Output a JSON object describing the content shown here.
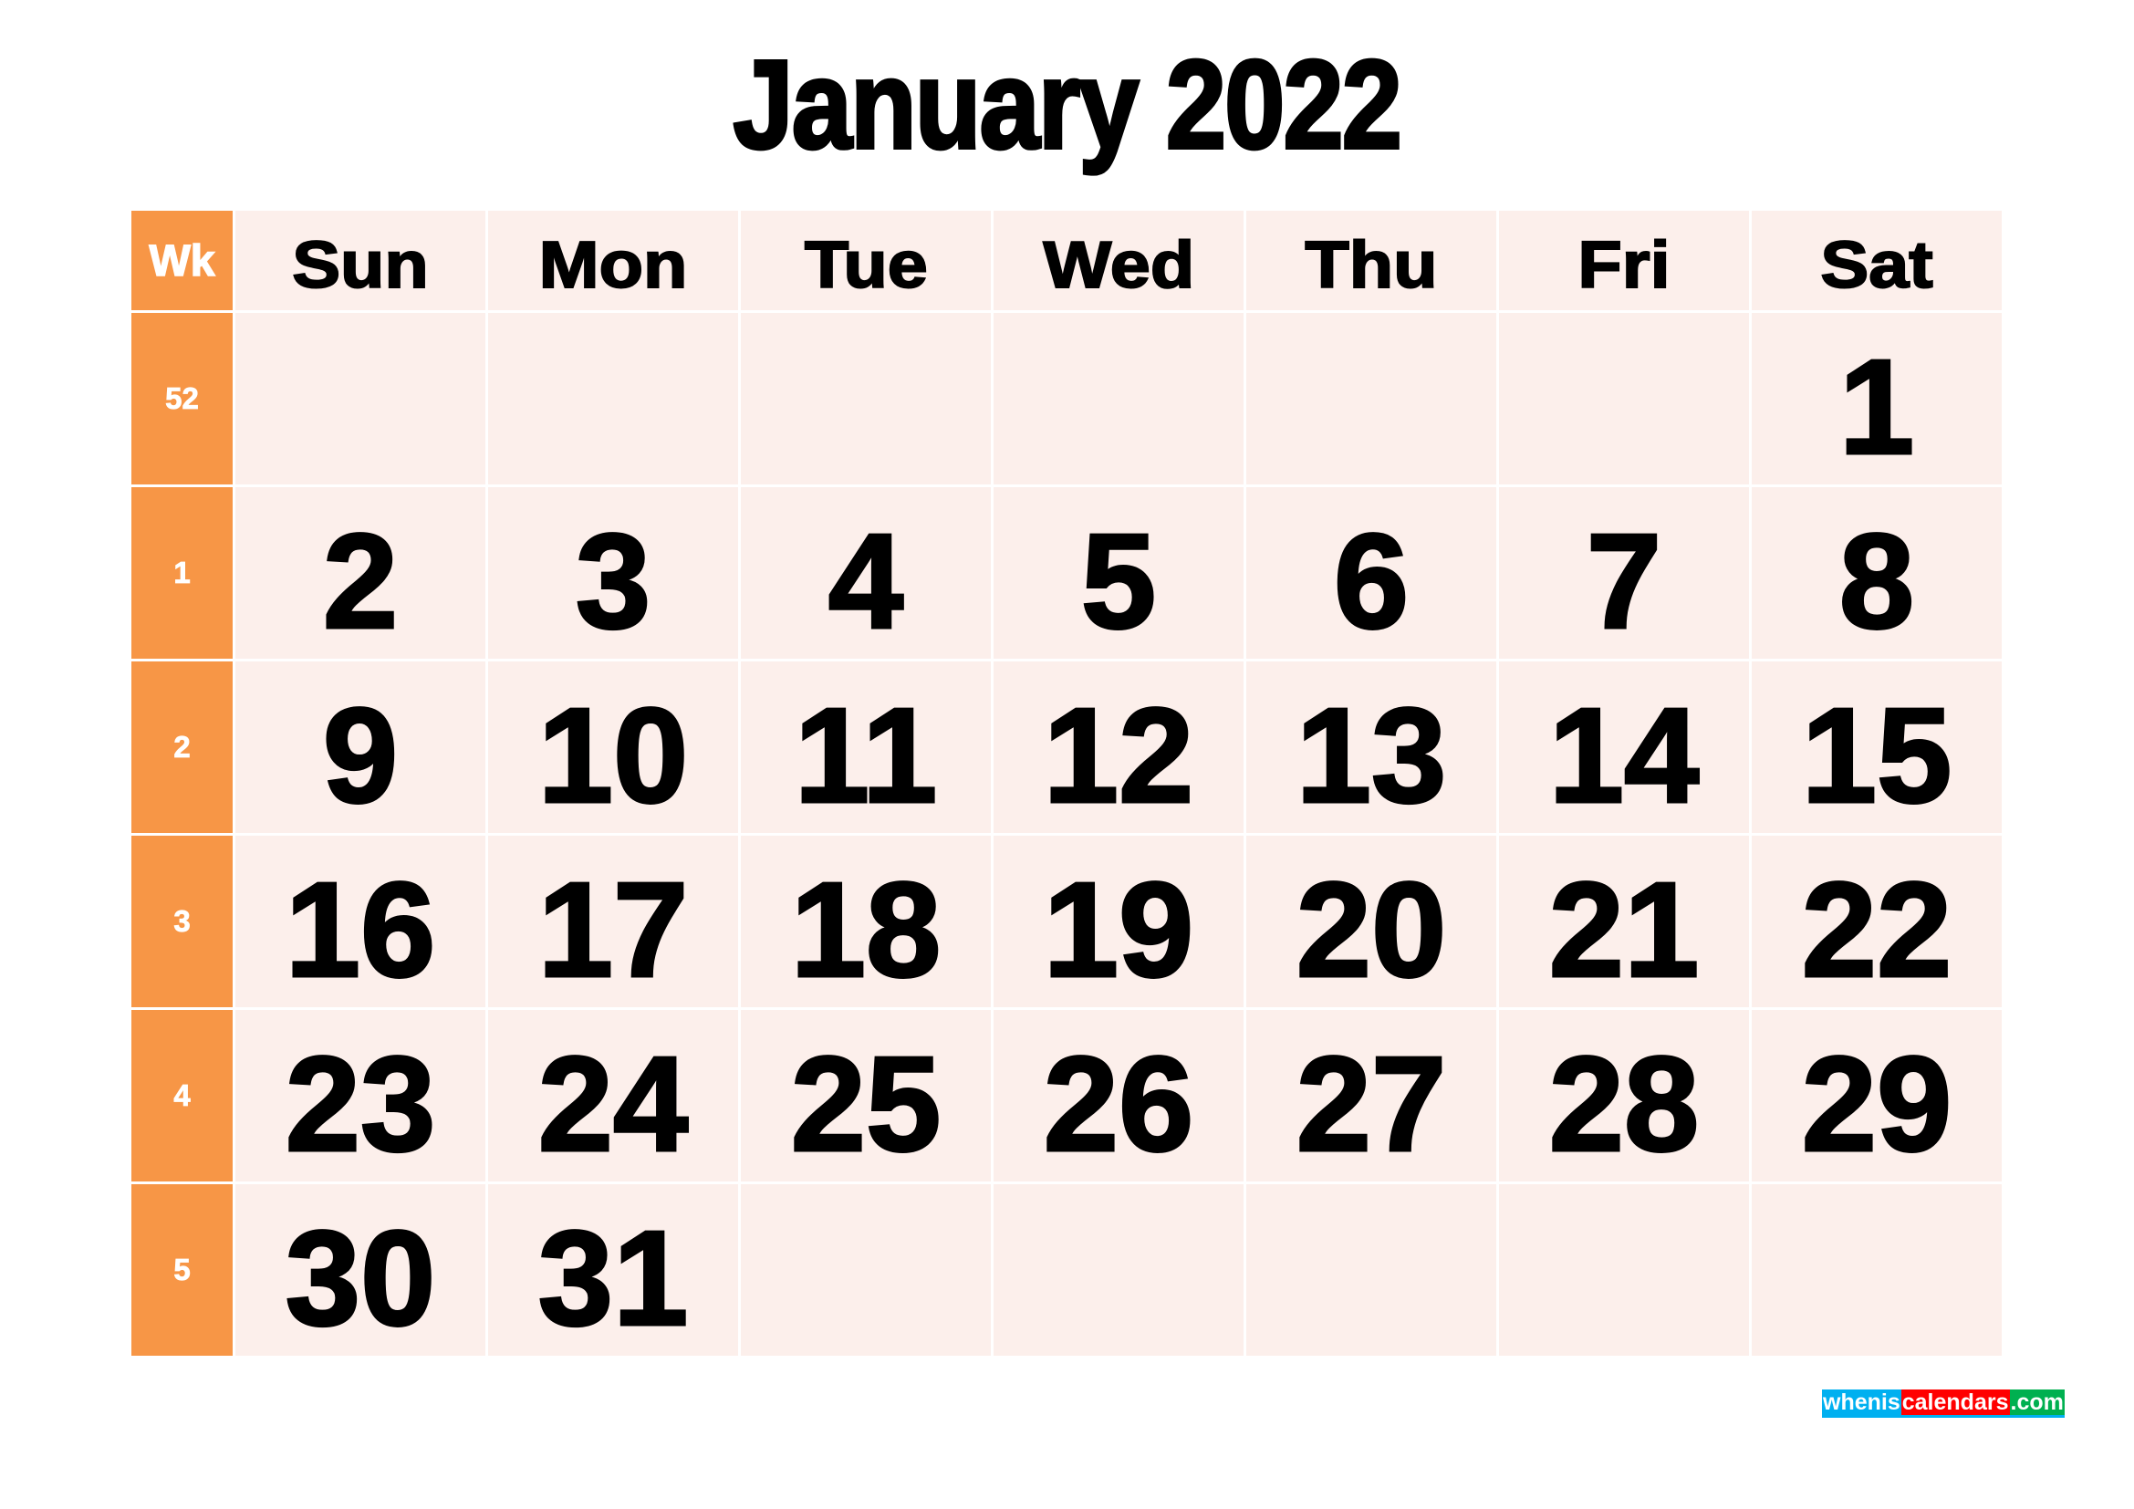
{
  "title": "January 2022",
  "month": "January",
  "year": "2022",
  "header": {
    "week_label": "Wk",
    "weekdays": [
      "Sun",
      "Mon",
      "Tue",
      "Wed",
      "Thu",
      "Fri",
      "Sat"
    ]
  },
  "weeks": [
    {
      "week": "52",
      "days": [
        "",
        "",
        "",
        "",
        "",
        "",
        "1"
      ]
    },
    {
      "week": "1",
      "days": [
        "2",
        "3",
        "4",
        "5",
        "6",
        "7",
        "8"
      ]
    },
    {
      "week": "2",
      "days": [
        "9",
        "10",
        "11",
        "12",
        "13",
        "14",
        "15"
      ]
    },
    {
      "week": "3",
      "days": [
        "16",
        "17",
        "18",
        "19",
        "20",
        "21",
        "22"
      ]
    },
    {
      "week": "4",
      "days": [
        "23",
        "24",
        "25",
        "26",
        "27",
        "28",
        "29"
      ]
    },
    {
      "week": "5",
      "days": [
        "30",
        "31",
        "",
        "",
        "",
        "",
        ""
      ]
    }
  ],
  "colors": {
    "week_column": "#F79646",
    "cell_background": "#FCEFEB",
    "text": "#000000"
  },
  "watermark": {
    "parts": [
      "whenis",
      "calendars",
      ".com"
    ],
    "colors": [
      "#00B0F0",
      "#FF0000",
      "#00B050"
    ]
  }
}
